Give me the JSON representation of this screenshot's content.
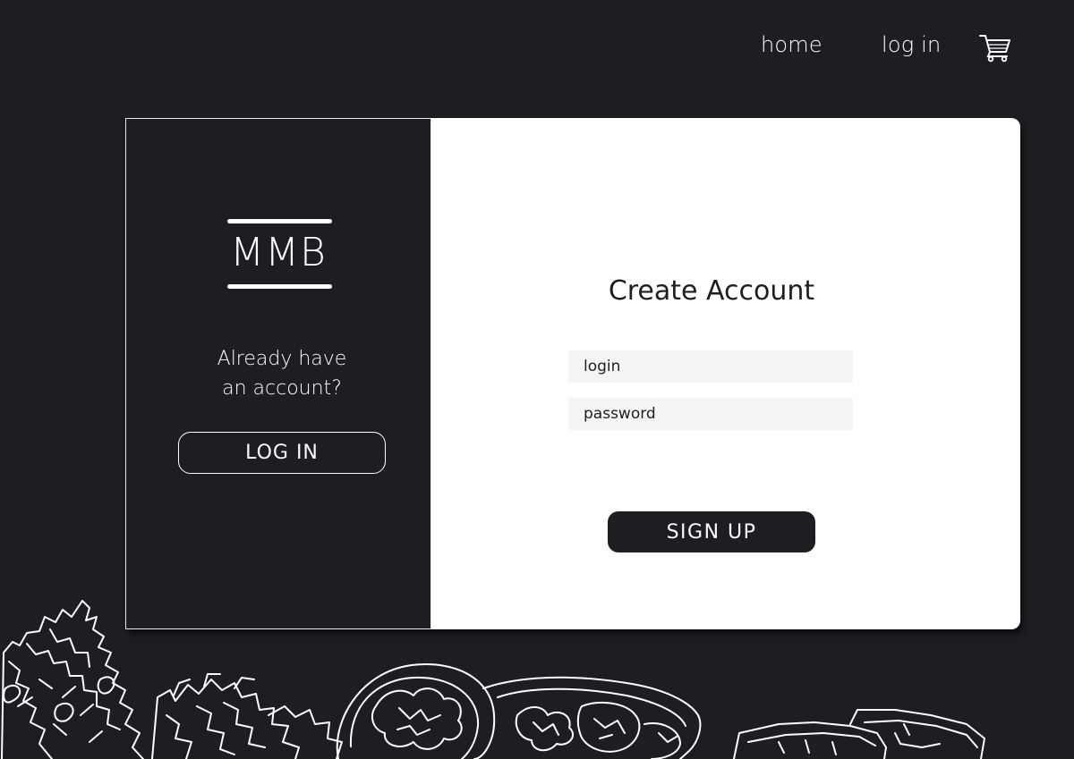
{
  "nav": {
    "home_label": "home",
    "login_label": "log in",
    "cart_icon": "shopping-cart-icon"
  },
  "left_panel": {
    "logo_text": "MMB",
    "prompt_line1": "Already have",
    "prompt_line2": "an account?",
    "login_button_label": "LOG IN"
  },
  "form": {
    "title": "Create Account",
    "login_placeholder": "login",
    "password_placeholder": "password",
    "signup_button_label": "SIGN UP"
  },
  "colors": {
    "background": "#1c1e21",
    "card": "#ffffff",
    "field": "#f4f5f5"
  }
}
